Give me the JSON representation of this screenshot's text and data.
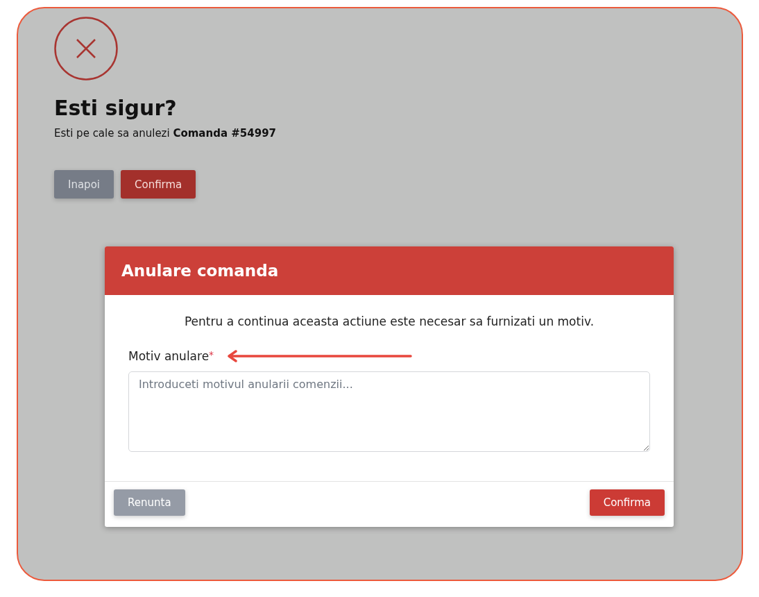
{
  "dialog": {
    "title": "Esti sigur?",
    "message": "Esti pe cale sa anulezi **Comanda #54997**",
    "buttons": [
      {
        "label": "Inapoi",
        "kind": "secondary"
      },
      {
        "label": "Confirma",
        "kind": "danger"
      }
    ]
  },
  "modal": {
    "title": "Anulare comanda",
    "description": "Pentru a continua aceasta actiune este necesar sa furnizati un motiv.",
    "field": {
      "label": "Motiv anulare",
      "required_mark": "*",
      "placeholder": "Introduceti motivul anularii comenzii..."
    },
    "buttons": [
      {
        "label": "Renunta",
        "kind": "secondary"
      },
      {
        "label": "Confirma",
        "kind": "danger"
      }
    ]
  }
}
